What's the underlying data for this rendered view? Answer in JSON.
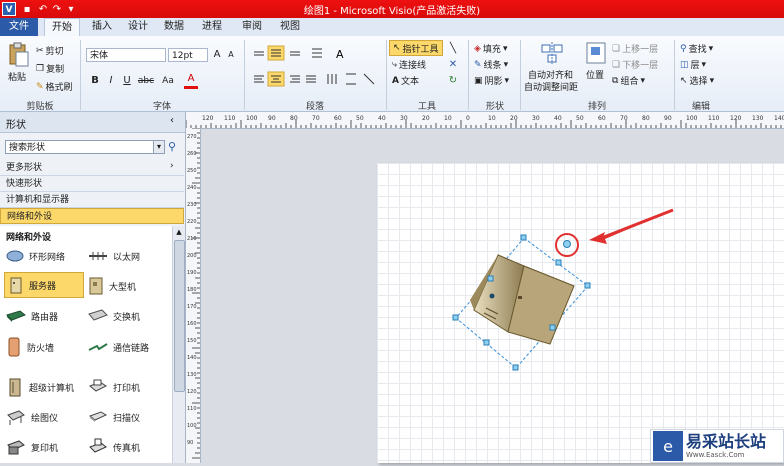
{
  "window": {
    "title": "绘图1 - Microsoft Visio(产品激活失败)",
    "app_icon": "V"
  },
  "quick_access": {
    "save": "save-icon",
    "undo": "undo-icon",
    "redo": "redo-icon",
    "customize": "customize-icon"
  },
  "tabs": [
    "文件",
    "开始",
    "插入",
    "设计",
    "数据",
    "进程",
    "审阅",
    "视图"
  ],
  "ribbon": {
    "clipboard": {
      "paste": "粘贴",
      "cut": "剪切",
      "copy": "复制",
      "format_painter": "格式刷",
      "group": "剪贴板"
    },
    "font": {
      "name": "宋体",
      "size": "12pt",
      "bold": "B",
      "italic": "I",
      "underline": "U",
      "strike": "abc",
      "case": "Aa",
      "color": "A",
      "group": "字体"
    },
    "paragraph": {
      "group": "段落"
    },
    "tools": {
      "pointer": "指针工具",
      "connector": "连接线",
      "text": "文本",
      "group": "工具"
    },
    "shape": {
      "fill": "填充",
      "line": "线条",
      "shadow": "阴影",
      "group": "形状"
    },
    "arrange": {
      "align": "自动对齐和",
      "align2": "自动调整间距",
      "position": "位置",
      "bring_forward": "上移一层",
      "send_backward": "下移一层",
      "group_btn": "组合",
      "group": "排列"
    },
    "editing": {
      "find": "查找",
      "layers": "层",
      "select": "选择",
      "group": "编辑"
    }
  },
  "shapes_pane": {
    "title": "形状",
    "search_placeholder": "搜索形状",
    "rows": [
      "更多形状",
      "快速形状",
      "计算机和显示器",
      "网络和外设"
    ],
    "stencil_title": "网络和外设",
    "items": [
      {
        "label": "环形网络",
        "icon": "ring-network-icon"
      },
      {
        "label": "以太网",
        "icon": "ethernet-icon"
      },
      {
        "label": "服务器",
        "icon": "server-icon"
      },
      {
        "label": "大型机",
        "icon": "mainframe-icon"
      },
      {
        "label": "路由器",
        "icon": "router-icon"
      },
      {
        "label": "交换机",
        "icon": "switch-icon"
      },
      {
        "label": "防火墙",
        "icon": "firewall-icon"
      },
      {
        "label": "通信链路",
        "icon": "comm-link-icon"
      },
      {
        "label": "超级计算机",
        "icon": "supercomputer-icon"
      },
      {
        "label": "打印机",
        "icon": "printer-icon"
      },
      {
        "label": "绘图仪",
        "icon": "plotter-icon"
      },
      {
        "label": "扫描仪",
        "icon": "scanner-icon"
      },
      {
        "label": "复印机",
        "icon": "copier-icon"
      },
      {
        "label": "传真机",
        "icon": "fax-icon"
      }
    ]
  },
  "ruler_labels": [
    "120",
    "110",
    "100",
    "90",
    "80",
    "70",
    "60",
    "50",
    "40",
    "30",
    "20",
    "10",
    "0",
    "10",
    "20",
    "30",
    "40",
    "50",
    "60",
    "70",
    "80",
    "90",
    "100",
    "110",
    "120",
    "130",
    "140"
  ],
  "vruler_labels": [
    "270",
    "260",
    "250",
    "240",
    "230",
    "220",
    "210",
    "200",
    "190",
    "180",
    "170",
    "160",
    "150",
    "140",
    "130",
    "120",
    "110",
    "100",
    "90",
    "80"
  ],
  "watermark": {
    "text": "易采站长站",
    "sub": "Www.Easck.Com"
  },
  "colors": {
    "title_bar": "#e01010",
    "file_tab": "#2b5aa8",
    "selected_row": "#fcd86a",
    "annotation": "#e03030"
  }
}
